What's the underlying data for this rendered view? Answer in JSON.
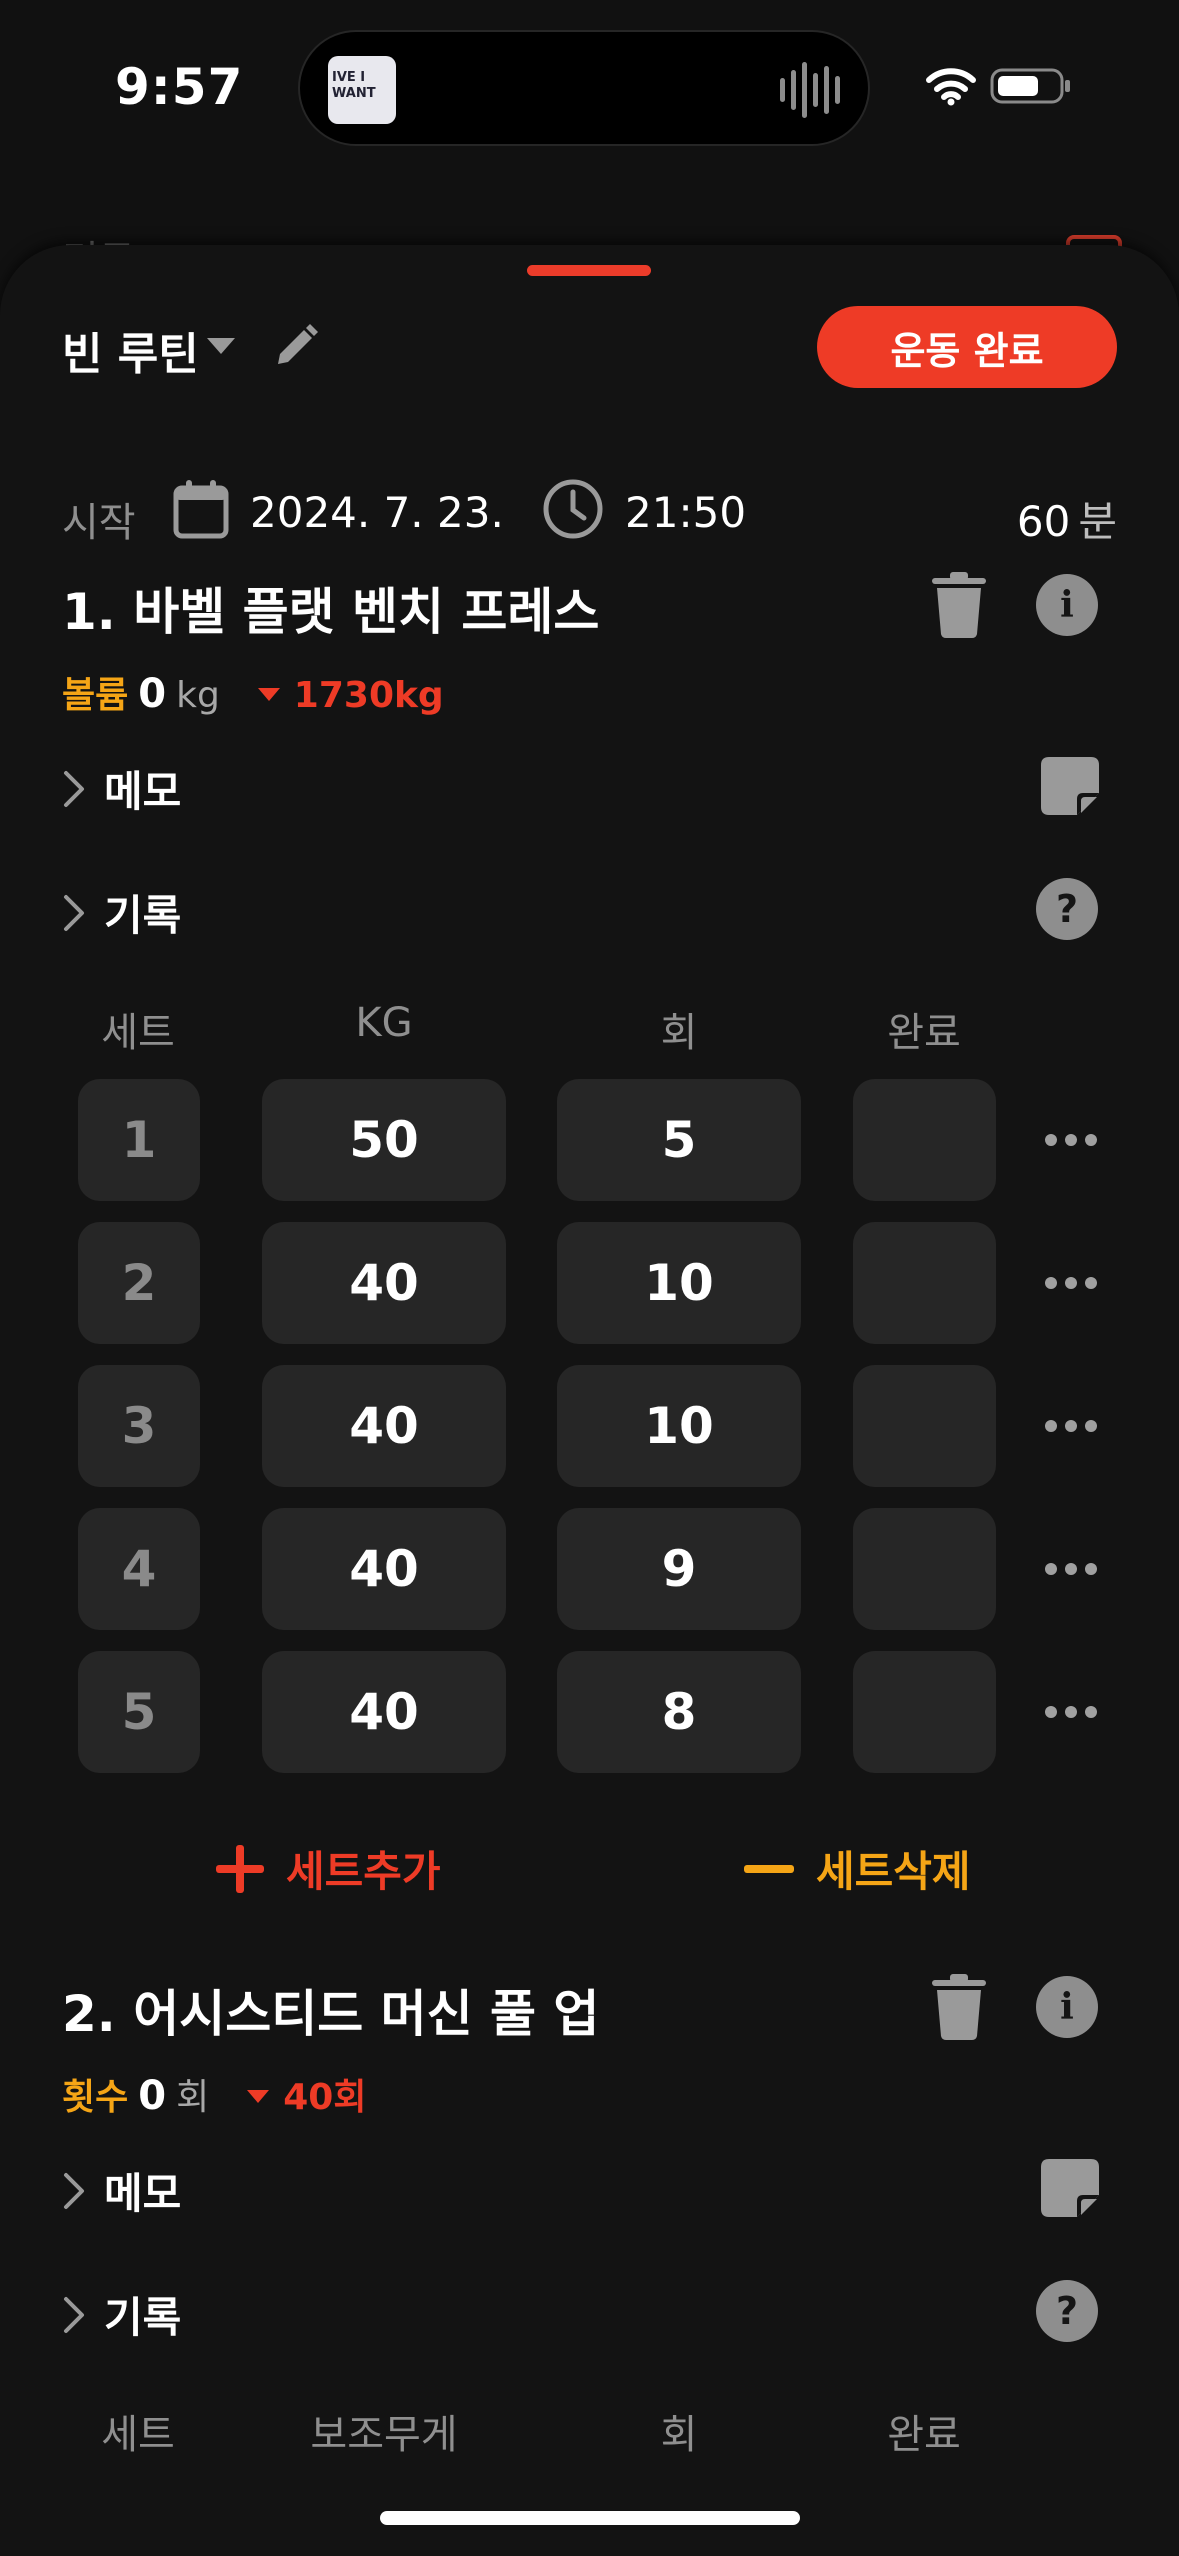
{
  "status": {
    "time": "9:57",
    "now_playing_art": "IVE I WANT"
  },
  "sheet": {
    "peek_title": "리구"
  },
  "header": {
    "routine_name": "빈 루틴",
    "finish_button": "운동 완료"
  },
  "start": {
    "label": "시작",
    "date": "2024. 7. 23.",
    "time": "21:50",
    "duration_value": "60",
    "duration_unit": "분"
  },
  "exercise1": {
    "title": "1. 바벨 플랫 벤치 프레스",
    "stat_label": "볼륨",
    "stat_value": "0",
    "stat_unit": "kg",
    "stat_diff": "1730kg",
    "memo_label": "메모",
    "history_label": "기록",
    "columns": [
      "세트",
      "KG",
      "회",
      "완료"
    ],
    "sets": [
      {
        "set": "1",
        "kg": "50",
        "reps": "5"
      },
      {
        "set": "2",
        "kg": "40",
        "reps": "10"
      },
      {
        "set": "3",
        "kg": "40",
        "reps": "10"
      },
      {
        "set": "4",
        "kg": "40",
        "reps": "9"
      },
      {
        "set": "5",
        "kg": "40",
        "reps": "8"
      }
    ],
    "add_set": "세트추가",
    "delete_set": "세트삭제"
  },
  "exercise2": {
    "title": "2. 어시스티드 머신 풀 업",
    "stat_label": "횟수",
    "stat_value": "0",
    "stat_unit": "회",
    "stat_diff": "40회",
    "memo_label": "메모",
    "history_label": "기록",
    "columns": [
      "세트",
      "보조무게",
      "회",
      "완료"
    ]
  },
  "colors": {
    "accent_red": "#ee3b26",
    "accent_yellow": "#f5a516",
    "cell_bg": "#262626"
  },
  "icons": [
    "calendar-icon",
    "clock-icon",
    "pencil-icon",
    "trash-icon",
    "info-icon",
    "memo-icon",
    "help-icon",
    "more-icon",
    "plus-icon",
    "minus-icon"
  ]
}
